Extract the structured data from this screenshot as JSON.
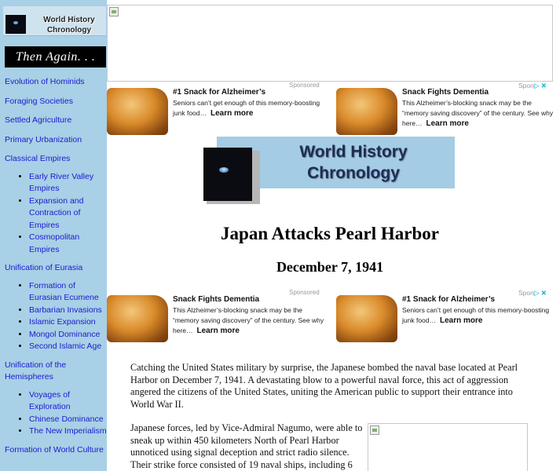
{
  "sidebar": {
    "logo_text": "World History Chronology",
    "tagline": "Then Again. . .",
    "nav": [
      {
        "label": "Evolution of Hominids",
        "children": []
      },
      {
        "label": "Foraging Societies",
        "children": []
      },
      {
        "label": "Settled Agriculture",
        "children": []
      },
      {
        "label": "Primary Urbanization",
        "children": []
      },
      {
        "label": "Classical Empires",
        "children": [
          "Early River Valley Empires",
          "Expansion and Contraction of Empires",
          "Cosmopolitan Empires"
        ]
      },
      {
        "label": "Unification of Eurasia",
        "children": [
          "Formation of Eurasian Ecumene",
          "Barbarian Invasions",
          "Islamic Expansion",
          "Mongol Dominance",
          "Second Islamic Age"
        ]
      },
      {
        "label": "Unification of the Hemispheres",
        "children": [
          "Voyages of Exploration",
          "Chinese Dominance",
          "The New Imperialism"
        ]
      },
      {
        "label": "Formation of World Culture",
        "children": []
      }
    ]
  },
  "ads": {
    "sponsored_label": "Sponsored",
    "choices_label": "Spon",
    "row1": [
      {
        "title": "#1 Snack for Alzheimer’s",
        "desc": "Seniors can’t get enough of this memory-boosting junk food…",
        "more": "Learn more"
      },
      {
        "title": "Snack Fights Dementia",
        "desc": "This Alzheimer’s-blocking snack may be the “memory saving discovery” of the century. See why here…",
        "more": "Learn more"
      }
    ],
    "row2": [
      {
        "title": "Snack Fights Dementia",
        "desc": "This Alzheimer’s-blocking snack may be the “memory saving discovery” of the century. See why here…",
        "more": "Learn more"
      },
      {
        "title": "#1 Snack for Alzheimer’s",
        "desc": "Seniors can’t get enough of this memory-boosting junk food…",
        "more": "Learn more"
      }
    ]
  },
  "header": {
    "logo_text": "World History Chronology"
  },
  "article": {
    "title": "Japan Attacks Pearl Harbor",
    "date": "December 7, 1941",
    "paragraphs": [
      "Catching the United States military by surprise, the Japanese bombed the naval base located at Pearl Harbor on December 7, 1941. A devastating blow to a powerful naval force, this act of aggression angered the citizens of the United States, uniting the American public to support their entrance into World War II.",
      "Japanese forces, led by Vice-Admiral Nagumo, were able to sneak up within 450 kilometers North of Pearl Harbor unnoticed using signal deception and strict radio silence. Their strike force consisted of 19 naval ships, including 6"
    ]
  },
  "colors": {
    "sidebar_bg": "#a8d0e6",
    "link": "#1a1ad0",
    "ad_choices": "#00aecd"
  }
}
